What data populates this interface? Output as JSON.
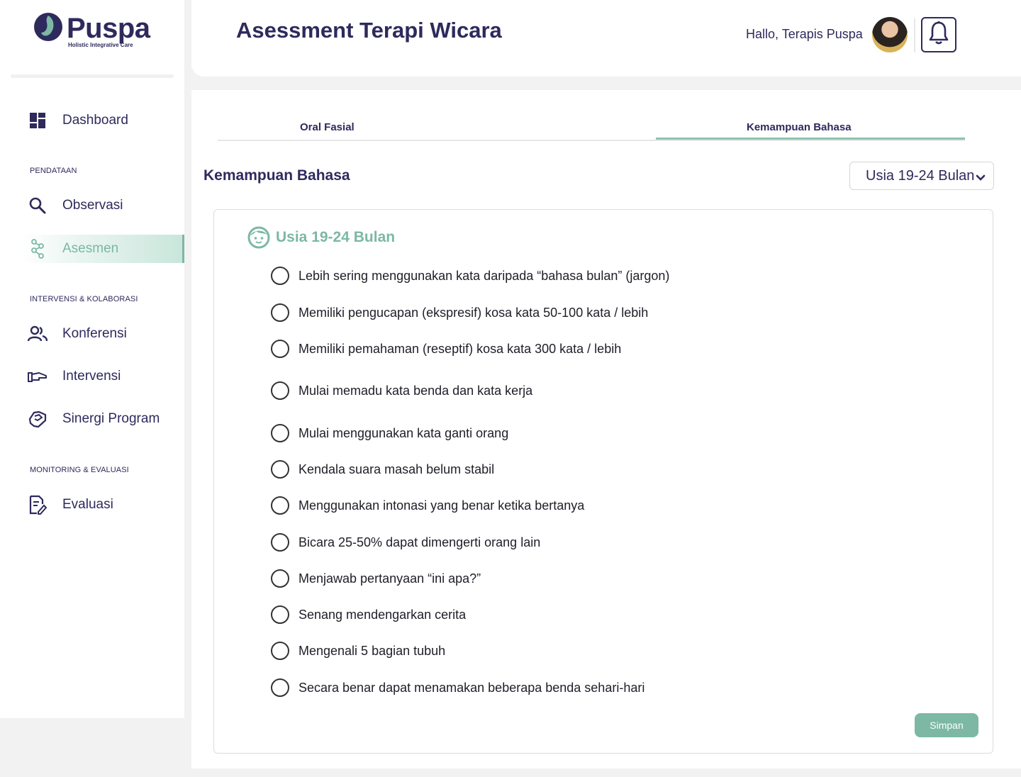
{
  "brand": {
    "name": "Puspa",
    "tagline": "Holistic Integrative Care"
  },
  "sidebar": {
    "items": [
      {
        "label": "Dashboard",
        "icon": "dashboard-icon"
      },
      {
        "label": "Observasi",
        "icon": "search-icon"
      },
      {
        "label": "Asesmen",
        "icon": "molecule-icon",
        "active": true
      },
      {
        "label": "Konferensi",
        "icon": "people-icon"
      },
      {
        "label": "Intervensi",
        "icon": "hand-icon"
      },
      {
        "label": "Sinergi Program",
        "icon": "handshake-icon"
      },
      {
        "label": "Evaluasi",
        "icon": "document-edit-icon"
      }
    ],
    "sections": [
      "PENDATAAN",
      "INTERVENSI & KOLABORASI",
      "MONITORING & EVALUASI"
    ]
  },
  "header": {
    "title": "Asessment Terapi Wicara",
    "greeting": "Hallo, Terapis Puspa"
  },
  "tabs": [
    {
      "label": "Oral Fasial",
      "active": false
    },
    {
      "label": "Kemampuan Bahasa",
      "active": true
    }
  ],
  "main": {
    "section_title": "Kemampuan Bahasa",
    "age_select": "Usia 19-24 Bulan",
    "card_title": "Usia 19-24 Bulan",
    "questions": [
      "Lebih sering menggunakan kata daripada “bahasa bulan” (jargon)",
      "Memiliki pengucapan (ekspresif) kosa kata 50-100 kata / lebih",
      "Memiliki pemahaman (reseptif) kosa kata 300 kata / lebih",
      "Mulai memadu kata benda dan kata kerja",
      "Mulai menggunakan kata ganti orang",
      "Kendala suara masah belum stabil",
      "Menggunakan intonasi yang benar ketika bertanya",
      "Bicara 25-50% dapat dimengerti orang lain",
      "Menjawab pertanyaan “ini apa?”",
      "Senang mendengarkan cerita",
      "Mengenali 5 bagian tubuh",
      "Secara benar dapat menamakan beberapa benda sehari-hari"
    ],
    "save_label": "Simpan"
  },
  "colors": {
    "primary": "#2e2a5c",
    "accent": "#7cb8a3",
    "background": "#f2f2f2"
  }
}
